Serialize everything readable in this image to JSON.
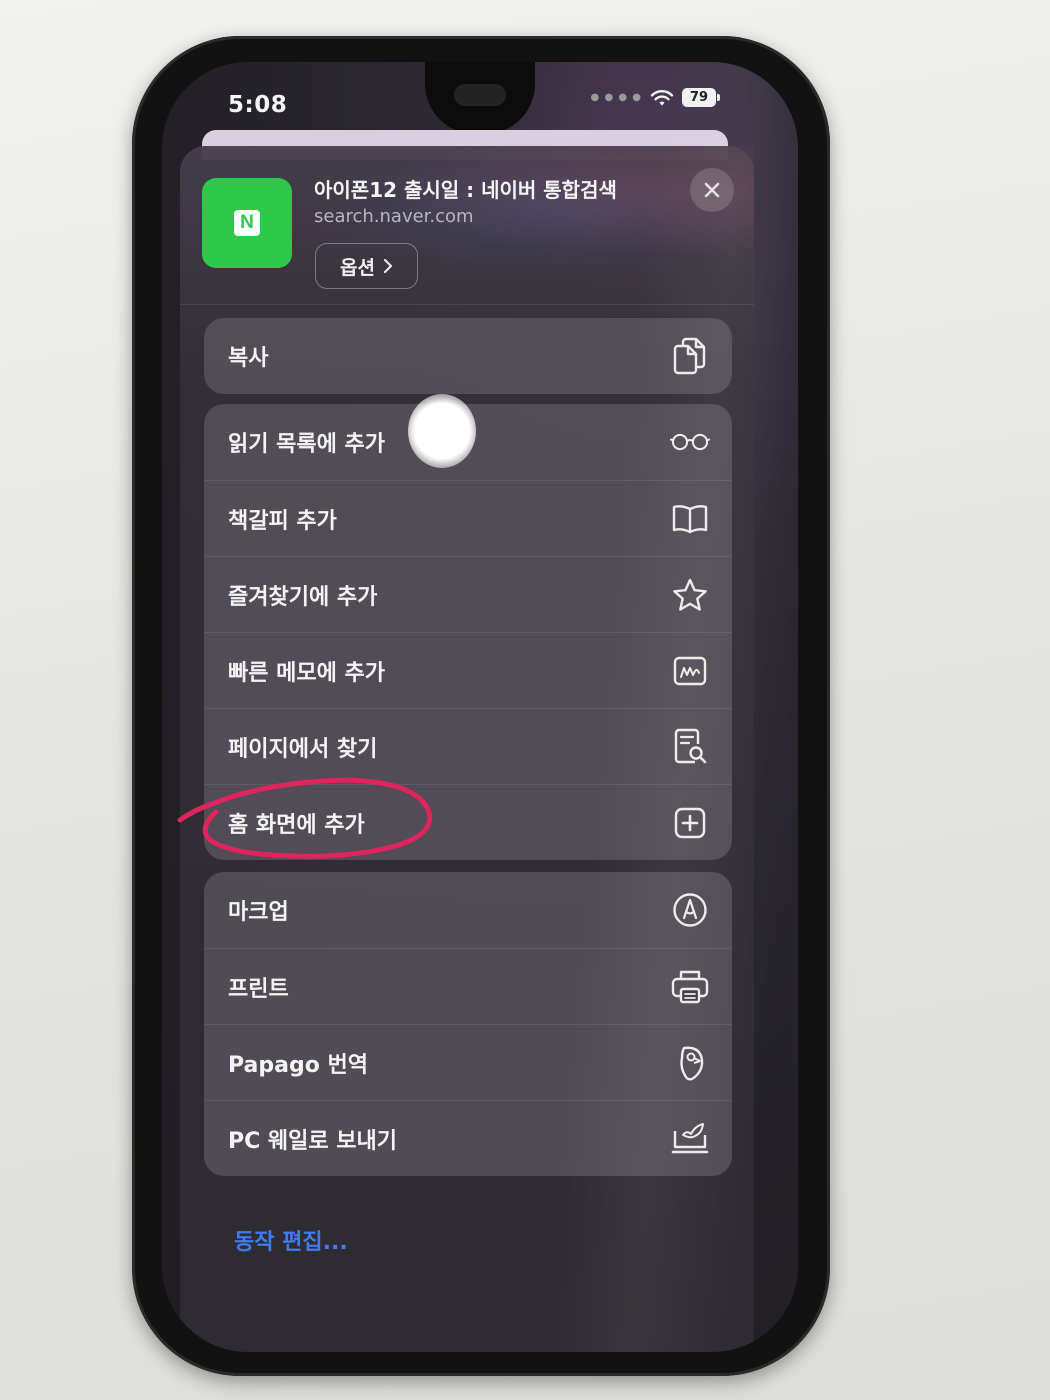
{
  "status_bar": {
    "time": "5:08",
    "battery": "79"
  },
  "share_sheet": {
    "page_title": "아이폰12 출시일 : 네이버 통합검색",
    "page_url": "search.naver.com",
    "site_icon_letter": "N",
    "site_icon_color": "#2ec84a",
    "options_label": "옵션"
  },
  "groups": [
    {
      "items": [
        {
          "label": "복사",
          "icon": "copy-icon"
        }
      ]
    },
    {
      "items": [
        {
          "label": "읽기 목록에 추가",
          "icon": "glasses-icon"
        },
        {
          "label": "책갈피 추가",
          "icon": "book-icon"
        },
        {
          "label": "즐겨찾기에 추가",
          "icon": "star-icon"
        },
        {
          "label": "빠른 메모에 추가",
          "icon": "quick-note-icon"
        },
        {
          "label": "페이지에서 찾기",
          "icon": "find-in-page-icon"
        },
        {
          "label": "홈 화면에 추가",
          "icon": "add-square-icon"
        }
      ]
    },
    {
      "items": [
        {
          "label": "마크업",
          "icon": "markup-icon"
        },
        {
          "label": "프린트",
          "icon": "printer-icon"
        },
        {
          "label": "Papago 번역",
          "icon": "papago-icon"
        },
        {
          "label": "PC 웨일로 보내기",
          "icon": "send-to-pc-icon"
        }
      ]
    }
  ],
  "edit_actions_label": "동작 편집...",
  "annotation": {
    "color": "#e0245e",
    "highlighted_item": "홈 화면에 추가"
  },
  "colors": {
    "link": "#3f7bf2",
    "sheet_background": "#2e2b32"
  }
}
